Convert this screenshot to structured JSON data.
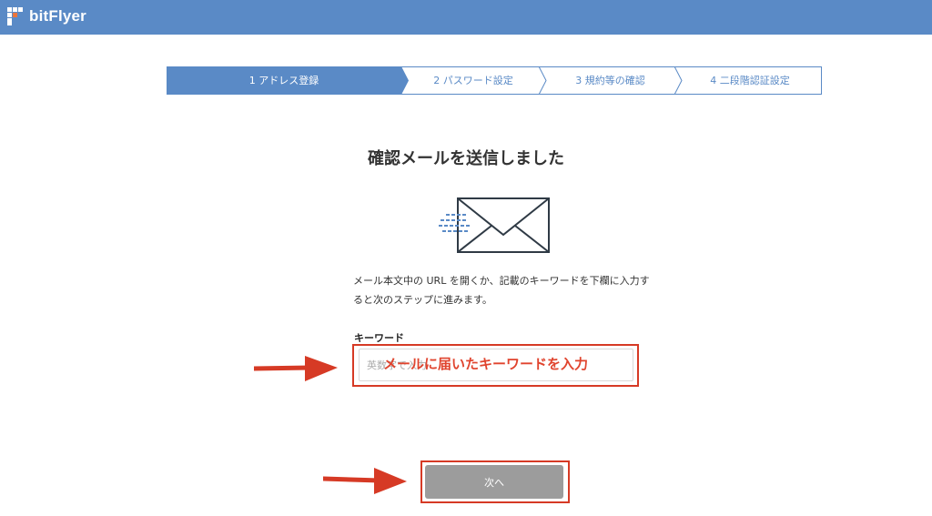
{
  "header": {
    "brand": "bitFlyer",
    "background": "#5a8ac6"
  },
  "steps": [
    {
      "label": "1 アドレス登録",
      "active": true
    },
    {
      "label": "2 パスワード設定",
      "active": false
    },
    {
      "label": "3 規約等の確認",
      "active": false
    },
    {
      "label": "4 二段階認証設定",
      "active": false
    }
  ],
  "main": {
    "title": "確認メールを送信しました",
    "mail_icon": "envelope-icon",
    "description": "メール本文中の URL を開くか、記載のキーワードを下欄に入力すると次のステップに進みます。",
    "keyword_label": "キーワード",
    "keyword_placeholder": "英数字で入力",
    "keyword_value": "",
    "next_label": "次へ"
  },
  "annotations": {
    "keyword_note": "メールに届いたキーワードを入力",
    "highlight_color": "#d63a25",
    "arrow_icon": "arrow-right-icon"
  }
}
